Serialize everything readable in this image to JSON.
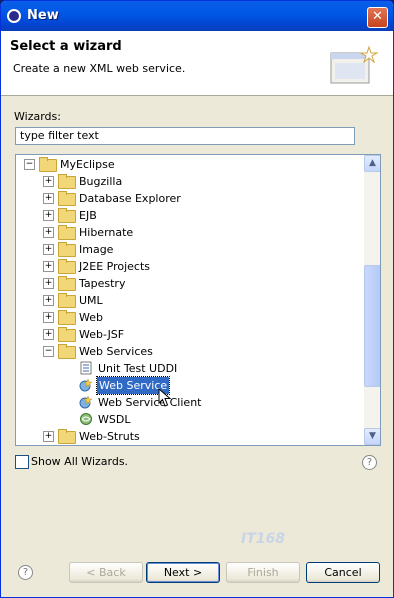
{
  "window": {
    "title": "New",
    "close_label": "✕"
  },
  "header": {
    "title": "Select a wizard",
    "description": "Create a new XML web service."
  },
  "wizards_label": "Wizards:",
  "filter": {
    "value": "type filter text"
  },
  "tree": {
    "root": "MyEclipse",
    "items": [
      "Bugzilla",
      "Database Explorer",
      "EJB",
      "Hibernate",
      "Image",
      "J2EE Projects",
      "Tapestry",
      "UML",
      "Web",
      "Web-JSF",
      "Web Services",
      "Unit Test UDDI",
      "Web Service",
      "Web Service Client",
      "WSDL",
      "Web-Struts"
    ],
    "selected": "Web Service"
  },
  "show_all_label": "Show All Wizards.",
  "buttons": {
    "back": "< Back",
    "next": "Next >",
    "finish": "Finish",
    "cancel": "Cancel",
    "help": "?"
  },
  "colors": {
    "selection": "#316ac5",
    "title_bar": "#0058e6"
  }
}
